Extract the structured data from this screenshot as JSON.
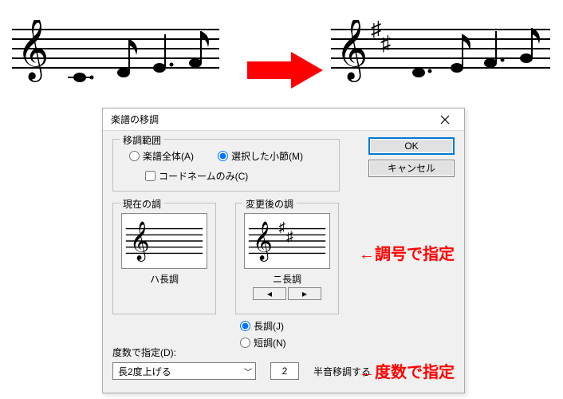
{
  "dialog": {
    "title": "楽譜の移調",
    "range_fs_legend": "移調範囲",
    "radio_whole": "楽譜全体(A)",
    "radio_selected": "選択した小節(M)",
    "chk_chord": "コードネームのみ(C)",
    "ok_label": "OK",
    "cancel_label": "キャンセル",
    "current_key_legend": "現在の調",
    "current_key_name": "ハ長調",
    "target_key_legend": "変更後の調",
    "target_key_name": "ニ長調",
    "mode_major": "長調(J)",
    "mode_minor": "短調(N)",
    "degree_label": "度数で指定(D):",
    "degree_combo": "長2度上げる",
    "semitone_value": "2",
    "semitone_label": "半音移調する"
  },
  "annotations": {
    "by_keysig": "←調号で指定",
    "by_degree": "←度数で指定"
  }
}
